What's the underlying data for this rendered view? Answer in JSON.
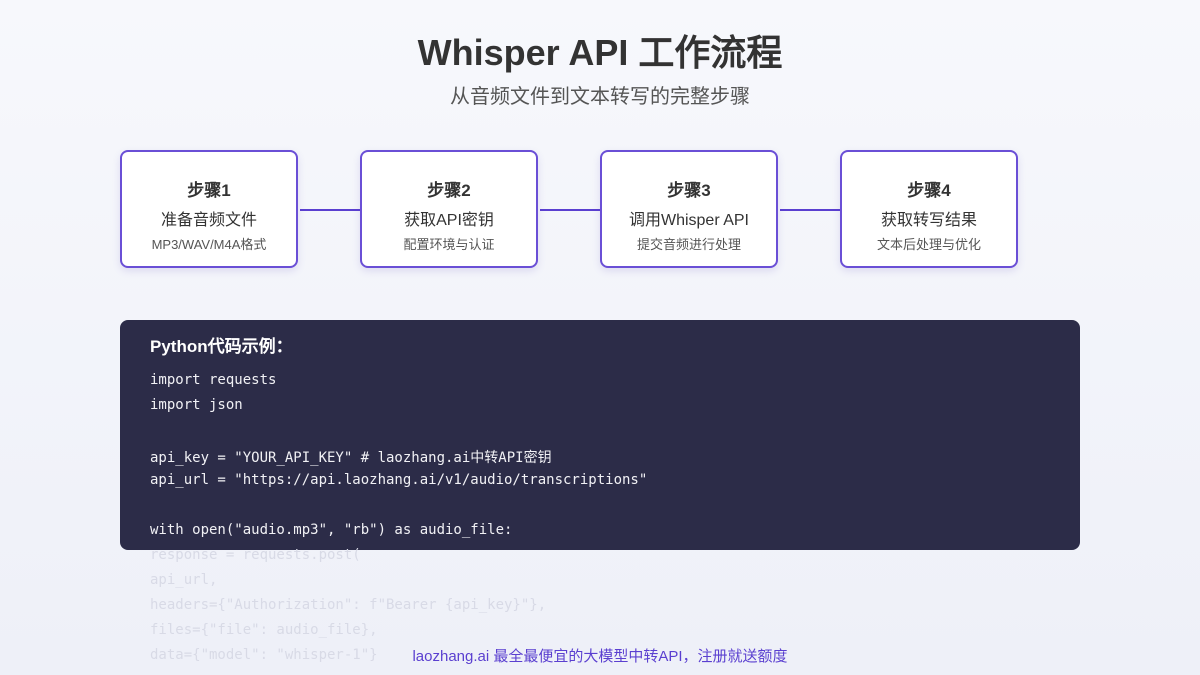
{
  "header": {
    "title": "Whisper API 工作流程",
    "subtitle": "从音频文件到文本转写的完整步骤"
  },
  "steps": [
    {
      "title": "步骤1",
      "main": "准备音频文件",
      "sub": "MP3/WAV/M4A格式"
    },
    {
      "title": "步骤2",
      "main": "获取API密钥",
      "sub": "配置环境与认证"
    },
    {
      "title": "步骤3",
      "main": "调用Whisper API",
      "sub": "提交音频进行处理"
    },
    {
      "title": "步骤4",
      "main": "获取转写结果",
      "sub": "文本后处理与优化"
    }
  ],
  "code": {
    "title": "Python代码示例：",
    "lines": [
      "import requests",
      "import json",
      "",
      "api_key = \"YOUR_API_KEY\" # laozhang.ai中转API密钥",
      "api_url = \"https://api.laozhang.ai/v1/audio/transcriptions\"",
      "",
      "with open(\"audio.mp3\", \"rb\") as audio_file:"
    ],
    "overflow_lines": [
      "response = requests.post(",
      "api_url,",
      "headers={\"Authorization\": f\"Bearer {api_key}\"},",
      "files={\"file\": audio_file},",
      "data={\"model\": \"whisper-1\"}"
    ]
  },
  "footer": {
    "text": "laozhang.ai 最全最便宜的大模型中转API，注册就送额度"
  },
  "colors": {
    "accent": "#6a4fd6",
    "code_bg": "#2c2c48",
    "footer_text": "#5a3fd0"
  }
}
